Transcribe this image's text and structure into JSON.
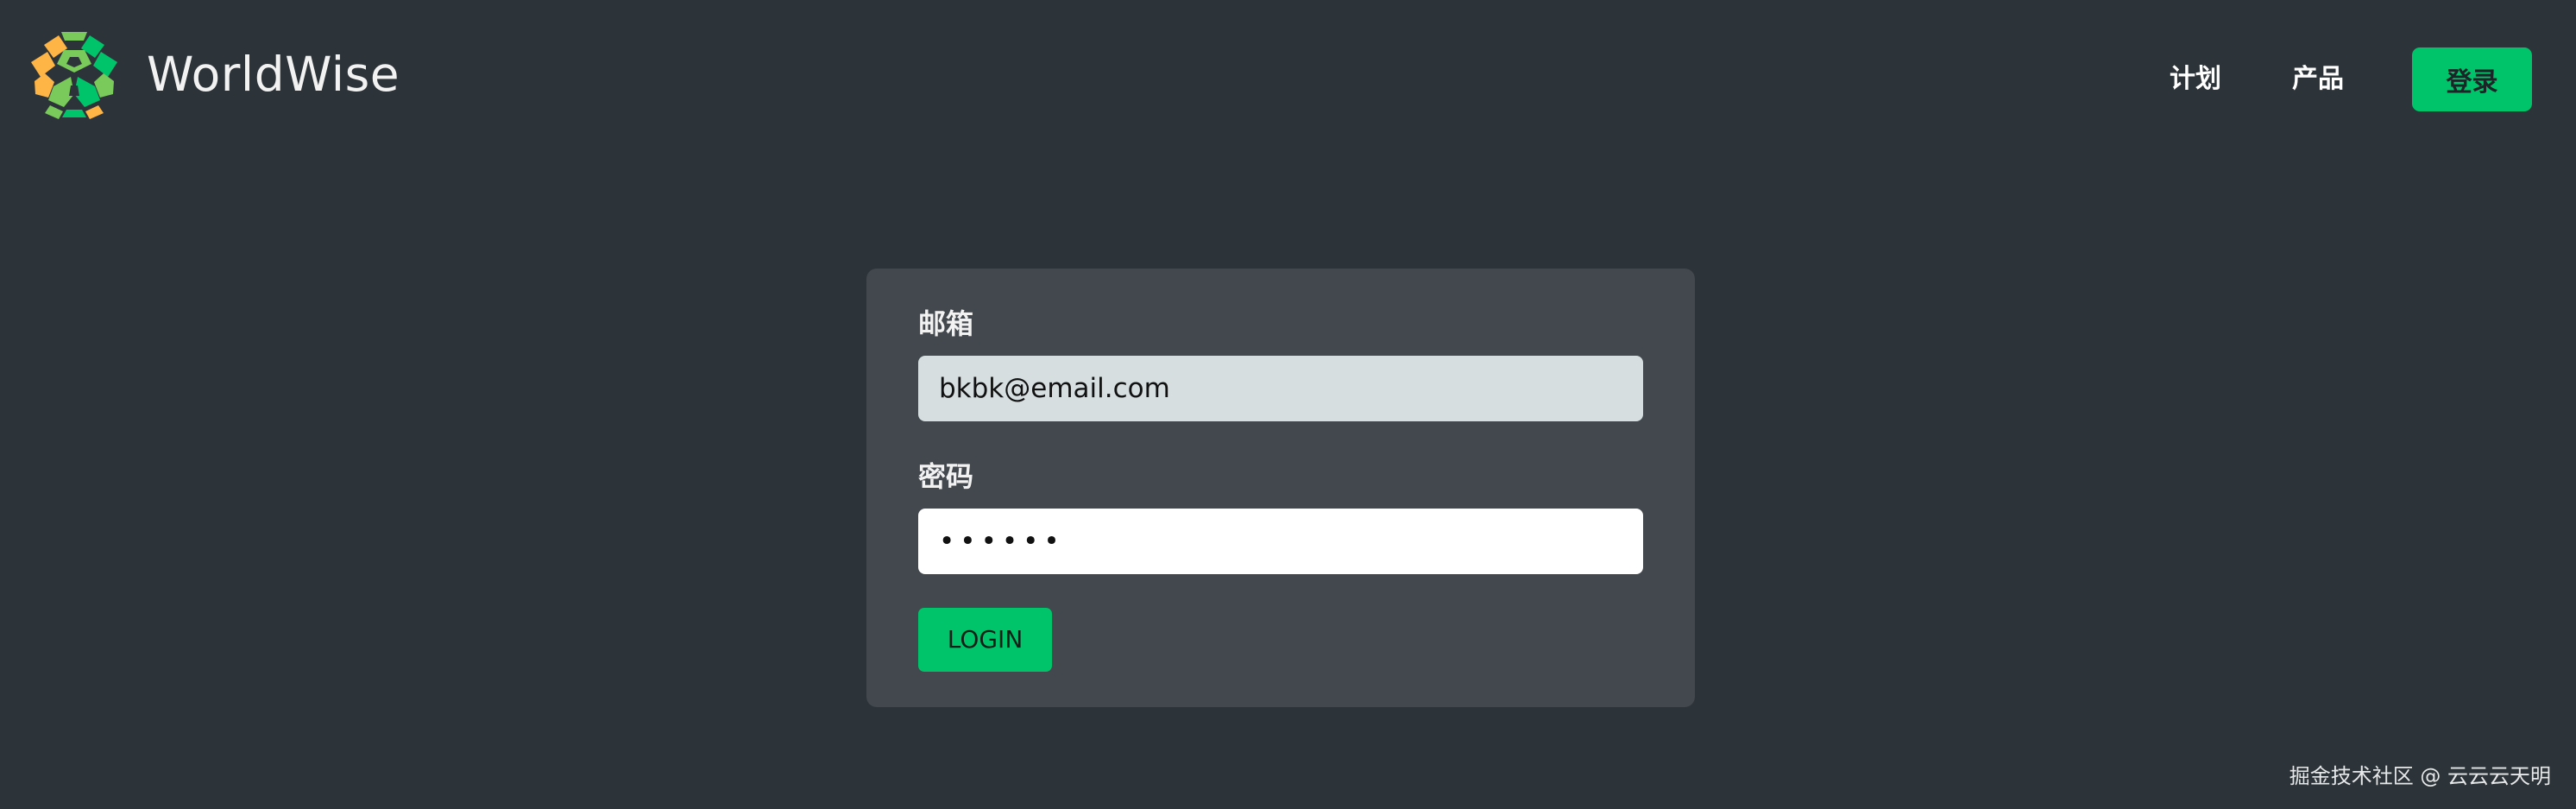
{
  "app": {
    "name": "WorldWise",
    "logo_icon": "globe-logo-icon"
  },
  "header": {
    "nav": {
      "plans_label": "计划",
      "products_label": "产品",
      "login_label": "登录"
    }
  },
  "login_form": {
    "email": {
      "label": "邮箱",
      "value": "bkbk@email.com"
    },
    "password": {
      "label": "密码",
      "value": "••••••"
    },
    "submit_label": "LOGIN"
  },
  "footer": {
    "watermark": "掘金技术社区 @ 云云云天明"
  },
  "colors": {
    "background": "#2d3439",
    "card": "#42484d",
    "accent": "#00c46a",
    "email_input_background": "#d6dee0",
    "password_input_background": "#ffffff",
    "logo_yellow": "#ffb545",
    "logo_green": "#00c46a",
    "logo_light_green": "#7ac95b"
  }
}
